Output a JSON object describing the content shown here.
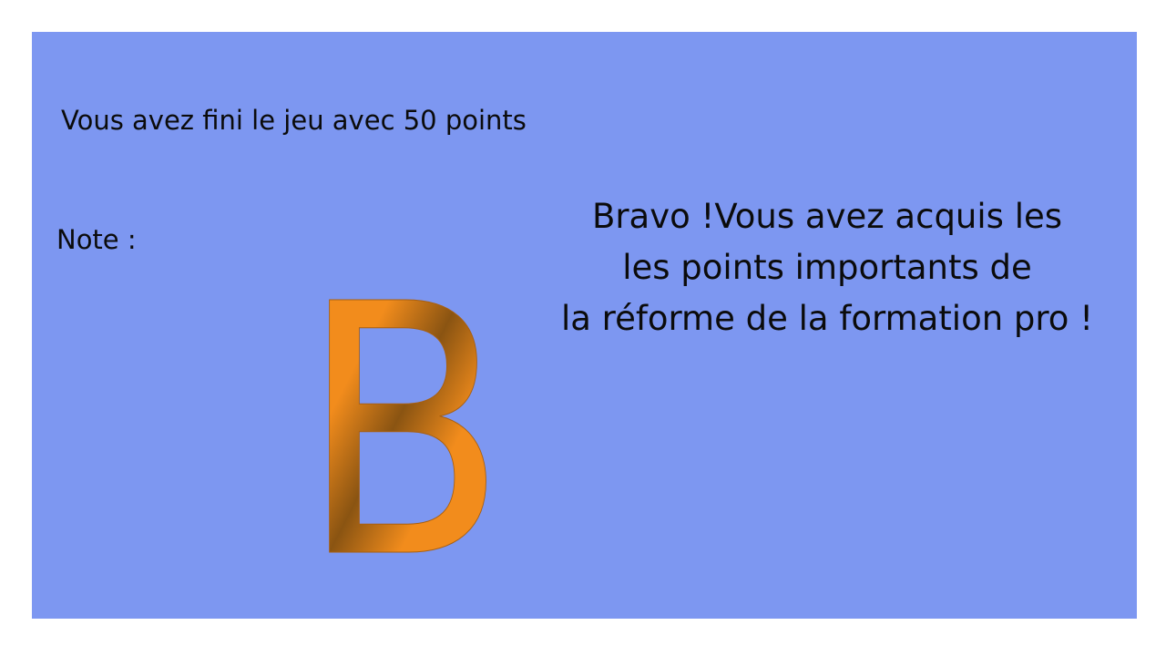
{
  "screen": {
    "background_color": "#ffffff",
    "panel_color": "#7d97f1"
  },
  "result": {
    "score_text": "Vous avez fini le jeu avec 50 points",
    "note_label": "Note :",
    "grade": "B",
    "grade_colors": {
      "light": "#f28c1c",
      "dark": "#8a5412"
    },
    "message_lines": [
      "Bravo !Vous avez acquis les",
      "les points importants de",
      "la réforme de la formation pro !"
    ]
  }
}
